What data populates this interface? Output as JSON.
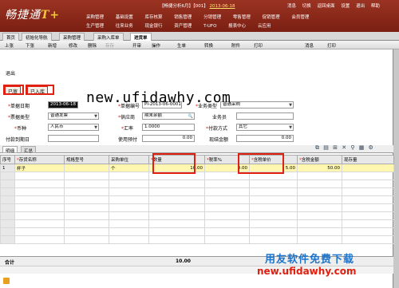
{
  "app": {
    "logo_text": "畅捷通",
    "logo_mark": "T+",
    "status_prefix": "【畅捷分析6月】【001】",
    "status_date": "2013-06-18",
    "top_links": [
      "消息",
      "切换",
      "返回桌面",
      "设置",
      "退出",
      "帮助"
    ],
    "menu_row1": [
      "采购管理",
      "基础设置",
      "库存核算",
      "销售管理",
      "分销管理",
      "零售管理",
      "促销管理",
      "会员管理"
    ],
    "menu_row2": [
      "生产管理",
      "往来业务",
      "现金银行",
      "资产管理",
      "T-UFO",
      "报表中心",
      "云应用"
    ]
  },
  "tabs": [
    {
      "label": "首页",
      "active": false
    },
    {
      "label": "初始化导航",
      "active": false
    },
    {
      "label": "采购管理",
      "active": false
    },
    {
      "label": "采购入库单",
      "active": false
    },
    {
      "label": "进货单",
      "active": true
    }
  ],
  "toolbar": [
    "上张",
    "下张",
    "新增",
    "修改",
    "删除",
    "存存",
    "开审",
    "操作",
    "生单",
    "转换",
    "附件",
    "打印",
    "消息",
    "打印"
  ],
  "exit_label": "退出",
  "buttons": {
    "draft": "已审",
    "stock": "已入库"
  },
  "watermark": "new.ufidawhy.com",
  "form": {
    "date_label": "单据日期",
    "date_value": "2013-06-18",
    "bill_no_label": "单据编号",
    "bill_no_value": "PI-2013-06-0001",
    "biz_type_label": "业务类型",
    "biz_type_value": "普通采购",
    "invoice_type_label": "票据类型",
    "invoice_type_value": "普通发票",
    "supplier_label": "供应商",
    "supplier_value": "期末余额",
    "salesman_label": "业务员",
    "salesman_value": "",
    "currency_label": "币种",
    "currency_value": "人民币",
    "rate_label": "汇率",
    "rate_value": "1.0000",
    "pay_method_label": "付款方式",
    "pay_method_value": "其它",
    "pay_date_label": "付款到期日",
    "pay_date_value": "",
    "prepay_label": "使用预付",
    "prepay_value": "0.00",
    "cash_label": "现结金额",
    "cash_value": "0.00"
  },
  "grid_tabs": [
    "明细",
    "汇总"
  ],
  "grid": {
    "headers": [
      "序号",
      "存货名称",
      "规格型号",
      "采购单位",
      "数量",
      "税率%",
      "含税单价",
      "含税金额",
      "现存量"
    ],
    "rows": [
      [
        "1",
        "杯子",
        "",
        "个",
        "10.00",
        "0.00",
        "5.00",
        "50.00",
        ""
      ]
    ]
  },
  "total_label": "合计",
  "total_qty": "10.00",
  "footer_brand": "用友软件免费下载",
  "footer_url": "new.ufidawhy.com",
  "colors": {
    "banner": "#8a2a1c",
    "highlight": "#e02010",
    "brand_blue": "#1e74c9"
  }
}
